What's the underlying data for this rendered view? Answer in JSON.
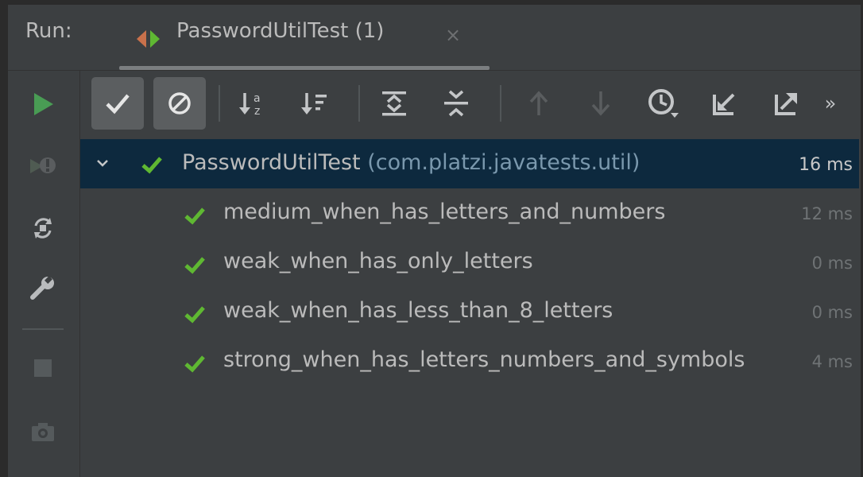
{
  "header": {
    "run_label": "Run:",
    "tab_title": "PasswordUtilTest (1)",
    "tab_close": "×"
  },
  "side_toolbar": [
    "play-icon",
    "rerun-failed-icon",
    "toggle-auto-test-icon",
    "wrench-icon",
    "stop-icon",
    "camera-icon"
  ],
  "toolbar": {
    "icons": [
      "show-passed-icon",
      "show-ignored-icon",
      "sort-alphabetically-icon",
      "sort-by-duration-icon",
      "expand-all-icon",
      "collapse-all-icon",
      "previous-failed-icon",
      "next-failed-icon",
      "test-history-icon",
      "import-tests-icon",
      "export-tests-icon",
      "more-icon"
    ],
    "more_glyph": "»"
  },
  "tree": {
    "root": {
      "name": "PasswordUtilTest",
      "package": "(com.platzi.javatests.util)",
      "time": "16 ms"
    },
    "children": [
      {
        "name": "medium_when_has_letters_and_numbers",
        "time": "12 ms"
      },
      {
        "name": "weak_when_has_only_letters",
        "time": "0 ms"
      },
      {
        "name": "weak_when_has_less_than_8_letters",
        "time": "0 ms"
      },
      {
        "name": "strong_when_has_letters_numbers_and_symbols",
        "time": "4 ms"
      }
    ]
  },
  "colors": {
    "background": "#3c3f41",
    "selection": "#0d293e",
    "passed_green": "#5fb832",
    "run_green": "#499c54"
  }
}
